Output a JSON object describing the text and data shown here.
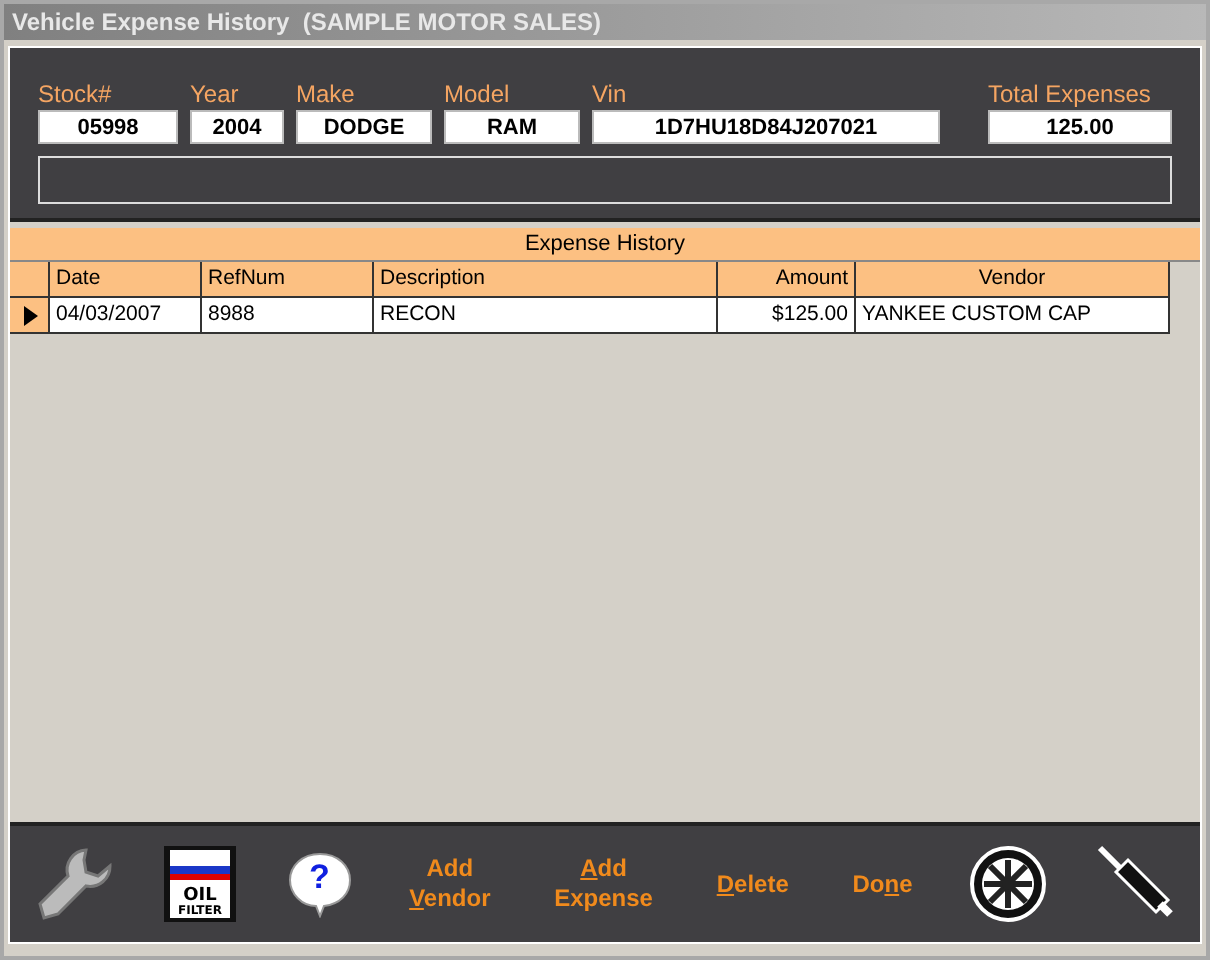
{
  "window": {
    "title": "Vehicle Expense History  (SAMPLE MOTOR SALES)"
  },
  "fields": [
    {
      "label": "Stock#",
      "value": "05998",
      "kind": "stock"
    },
    {
      "label": "Year",
      "value": "2004",
      "kind": "year"
    },
    {
      "label": "Make",
      "value": "DODGE",
      "kind": "make"
    },
    {
      "label": "Model",
      "value": "RAM",
      "kind": "model"
    },
    {
      "label": "Vin",
      "value": "1D7HU18D84J207021",
      "kind": "vin"
    },
    {
      "label": "Total Expenses",
      "value": "125.00",
      "kind": "total"
    }
  ],
  "table": {
    "title": "Expense History",
    "columns": [
      {
        "label": "Date"
      },
      {
        "label": "RefNum"
      },
      {
        "label": "Description"
      },
      {
        "label": "Amount"
      },
      {
        "label": "Vendor"
      }
    ],
    "rows": [
      {
        "selected": true,
        "cells": [
          "04/03/2007",
          "8988",
          "RECON",
          "$125.00",
          "YANKEE CUSTOM CAP"
        ]
      }
    ]
  },
  "toolbar": [
    {
      "kind": "wrench"
    },
    {
      "kind": "oil",
      "lines": [
        "OIL",
        "FILTER"
      ]
    },
    {
      "kind": "help",
      "glyph": "?"
    },
    {
      "kind": "text",
      "parts": [
        {
          "before": "Add"
        },
        {
          "key": "V",
          "after": "endor"
        }
      ]
    },
    {
      "kind": "text",
      "parts": [
        {
          "key": "A",
          "after": "dd"
        },
        {
          "before": "Expense"
        }
      ]
    },
    {
      "kind": "text",
      "parts": [
        {
          "key": "D",
          "after": "elete"
        }
      ]
    },
    {
      "kind": "text",
      "parts": [
        {
          "before": "Do",
          "key": "n",
          "after": "e"
        }
      ]
    },
    {
      "kind": "wheel"
    },
    {
      "kind": "plug"
    }
  ]
}
